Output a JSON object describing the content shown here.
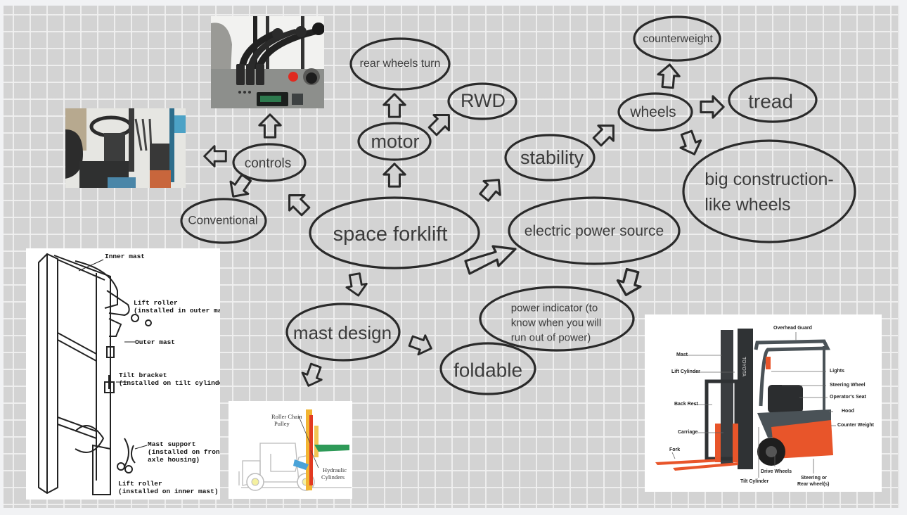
{
  "mindmap": {
    "central": "space forklift",
    "nodes": {
      "controls": "controls",
      "conventional": "Conventional",
      "motor": "motor",
      "rear_wheels_turn": "rear wheels turn",
      "rwd": "RWD",
      "stability": "stability",
      "wheels": "wheels",
      "counterweight": "counterweight",
      "tread": "tread",
      "big_wheels_line1": "big construction-",
      "big_wheels_line2": "like wheels",
      "electric_power": "electric power source",
      "power_indicator_line1": "power indicator (to",
      "power_indicator_line2": "know when you will",
      "power_indicator_line3": "run out of power)",
      "mast_design": "mast design",
      "foldable": "foldable"
    }
  },
  "images": {
    "controls_photo": {
      "subject": "forklift control levers and display panel"
    },
    "cab_photo": {
      "subject": "forklift operator cab interior"
    },
    "mast_diagram": {
      "labels": [
        "Inner mast",
        "Lift roller",
        "(installed in outer mast)",
        "Outer mast",
        "Tilt bracket",
        "(installed on tilt cylinder)",
        "Mast support",
        "(installed on front",
        "axle housing)",
        "Lift roller",
        "(installed on inner mast)"
      ]
    },
    "hydraulic_diagram": {
      "labels": [
        "Roller Chain",
        "Pulley",
        "Hydraulic",
        "Cylinders"
      ]
    },
    "forklift_parts": {
      "brand": "TOYOTA",
      "labels": {
        "overhead_guard": "Overhead Guard",
        "mast": "Mast",
        "lift_cylinder": "Lift Cylinder",
        "back_rest": "Back Rest",
        "carriage": "Carriage",
        "fork": "Fork",
        "lights": "Lights",
        "steering_wheel": "Steering Wheel",
        "operators_seat": "Operator's Seat",
        "hood": "Hood",
        "counter_weight": "Counter Weight",
        "drive_wheels": "Drive Wheels",
        "tilt_cylinder": "Tilt Cylinder",
        "steering_rear_1": "Steering or",
        "steering_rear_2": "Rear wheel(s)"
      }
    }
  },
  "colors": {
    "board": "#d3d3d3",
    "ink": "#2a2a2a",
    "text": "#3c3c3c",
    "forklift_orange": "#e8552a",
    "forklift_gray": "#4a5257"
  }
}
